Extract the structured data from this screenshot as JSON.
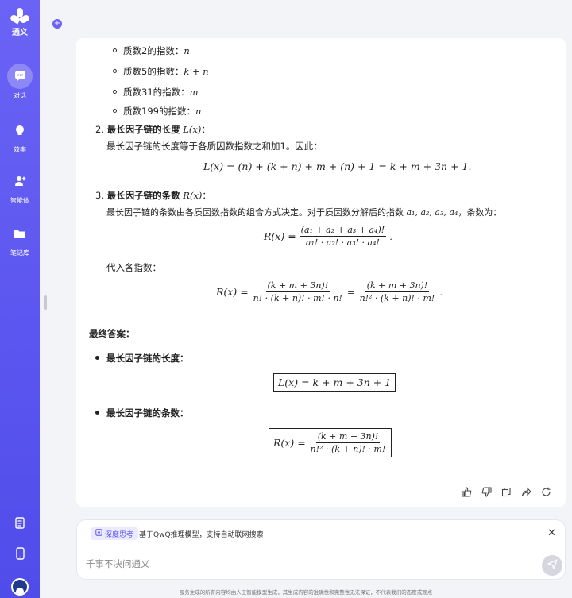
{
  "app": {
    "name": "通义"
  },
  "nav": [
    {
      "label": "对话",
      "icon": "chat-icon",
      "active": true
    },
    {
      "label": "效率",
      "icon": "bulb-icon",
      "active": false
    },
    {
      "label": "智能体",
      "icon": "agent-icon",
      "active": false
    },
    {
      "label": "笔记库",
      "icon": "folder-icon",
      "active": false
    }
  ],
  "content": {
    "exponents": [
      {
        "label": "质数2的指数：",
        "value": "n"
      },
      {
        "label": "质数5的指数：",
        "value": "k + n"
      },
      {
        "label": "质数31的指数：",
        "value": "m"
      },
      {
        "label": "质数199的指数：",
        "value": "n"
      }
    ],
    "section2": {
      "num": "2.",
      "title": "最长因子链的长度",
      "title_math": "L(x)",
      "colon": "：",
      "desc": "最长因子链的长度等于各质因数指数之和加1。因此：",
      "formula": "L(x) = (n) + (k + n) + m + (n) + 1 = k + m + 3n + 1."
    },
    "section3": {
      "num": "3.",
      "title": "最长因子链的条数",
      "title_math": "R(x)",
      "colon": "：",
      "desc_prefix": "最长因子链的条数由各质因数指数的组合方式决定。对于质因数分解后的指数",
      "desc_math": "a₁, a₂, a₃, a₄",
      "desc_suffix": "，条数为：",
      "f1_lhs": "R(x) =",
      "f1_num": "(a₁ + a₂ + a₃ + a₄)!",
      "f1_den": "a₁! · a₂! · a₃! · a₄!",
      "f1_end": ".",
      "sub_label": "代入各指数：",
      "f2_lhs": "R(x) =",
      "f2_num1": "(k + m + 3n)!",
      "f2_den1": "n! · (k + n)! · m! · n!",
      "f2_eq": "=",
      "f2_num2": "(k + m + 3n)!",
      "f2_den2": "n!² · (k + n)! · m!",
      "f2_end": "."
    },
    "final": {
      "heading": "最终答案：",
      "item1": "最长因子链的长度：",
      "box1": "L(x) = k + m + 3n + 1",
      "item2": "最长因子链的条数：",
      "box2_lhs": "R(x) =",
      "box2_num": "(k + m + 3n)!",
      "box2_den": "n!² · (k + n)! · m!"
    }
  },
  "input": {
    "badge": "深度思考",
    "hint": "基于QwQ推理模型，支持自动联网搜索",
    "placeholder": "千事不决问通义"
  },
  "footer": "服务生成的所有内容均由人工智能模型生成，其生成内容的准确性和完整性无法保证，不代表我们的态度或观点",
  "colors": {
    "sidebar": "#5a55ef",
    "accent": "#6b63f5"
  }
}
